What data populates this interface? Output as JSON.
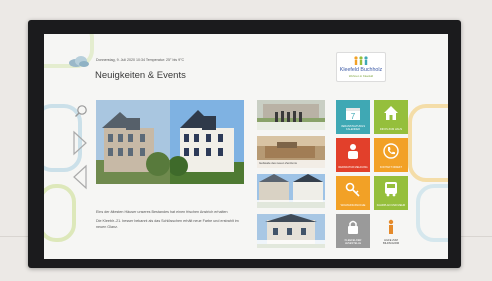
{
  "header": {
    "info_line": "Donnerstag, 9. Juli 2020 10:34  Temperatur: 25° bis 9°C",
    "title": "Neuigkeiten & Events"
  },
  "logo": {
    "name": "Kleefeld Buchholz",
    "tagline": "Wohnen in Kleefeld"
  },
  "feature": {
    "paragraph_1": "Eins der ältesten Häuser unseres Bestandes hat einen frischen Anstrich erhalten",
    "paragraph_2": "Die Kleeblr.-21. besser bekannt als das Schlösschen erhält neue Farbe und erstrahlt im neuen Glanz."
  },
  "thumbnails": [
    {
      "label": ""
    },
    {
      "label": "Gebäude des neuen Zentrums"
    },
    {
      "label": ""
    },
    {
      "label": ""
    }
  ],
  "tiles": [
    {
      "label": "VERANSTALTUNGS KALENDER",
      "icon": "calendar-icon",
      "color": "#3fa8b4"
    },
    {
      "label": "INFOS ZUM HAUS",
      "icon": "house-icon",
      "color": "#95bf3c"
    },
    {
      "label": "REPARATUR MELDUNG",
      "icon": "repair-person-icon",
      "color": "#e2402b"
    },
    {
      "label": "KONTAKT DIREKT",
      "icon": "phone-icon",
      "color": "#f2a126"
    },
    {
      "label": "WOHNUNGSSUCHE",
      "icon": "key-icon",
      "color": "#f2a126"
    },
    {
      "label": "FAHRPLAN UND MEHR",
      "icon": "bus-icon",
      "color": "#95bf3c"
    },
    {
      "label": "KLEEFELDER LESESTELLE",
      "icon": "lock-icon",
      "color": "#9a9a9a"
    },
    {
      "label": "HILFE ZUM BILDSCHIRM",
      "icon": "info-person-icon",
      "color": "#f6f6f4"
    }
  ],
  "calendar_day": "7"
}
